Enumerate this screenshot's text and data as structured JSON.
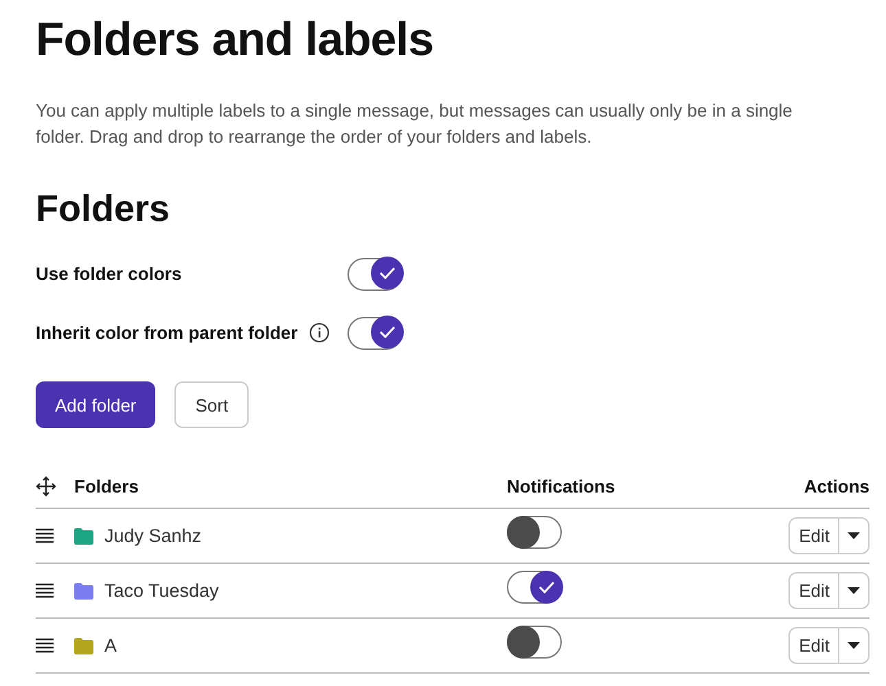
{
  "title": "Folders and labels",
  "description": "You can apply multiple labels to a single message, but messages can usually only be in a single folder. Drag and drop to rearrange the order of your folders and labels.",
  "section_title": "Folders",
  "settings": [
    {
      "label": "Use folder colors",
      "on": true,
      "info": false
    },
    {
      "label": "Inherit color from parent folder",
      "on": true,
      "info": true
    }
  ],
  "buttons": [
    {
      "label": "Add folder",
      "kind": "primary"
    },
    {
      "label": "Sort",
      "kind": "secondary"
    }
  ],
  "table": {
    "columns": [
      "Folders",
      "Notifications",
      "Actions"
    ],
    "rows": [
      {
        "name": "Judy Sanhz",
        "color": "#1da583",
        "notifications": false,
        "action": "Edit"
      },
      {
        "name": "Taco Tuesday",
        "color": "#7b7df0",
        "notifications": true,
        "action": "Edit"
      },
      {
        "name": "A",
        "color": "#b5a61f",
        "notifications": false,
        "action": "Edit"
      }
    ]
  }
}
